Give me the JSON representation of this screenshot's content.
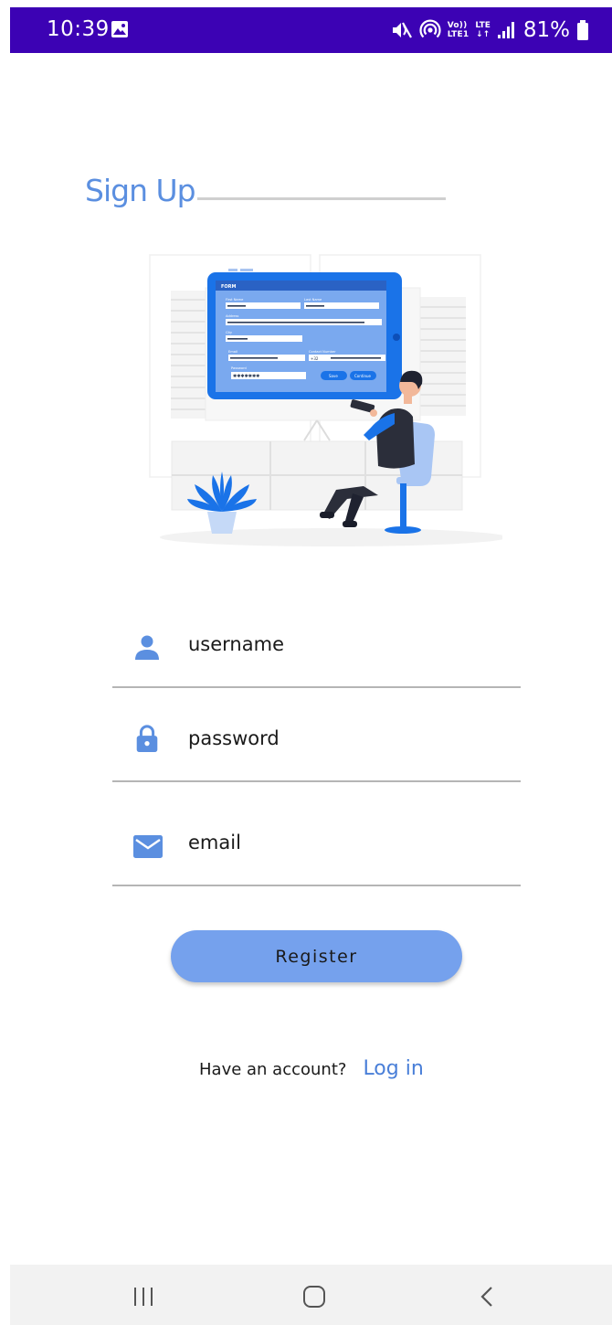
{
  "status_bar": {
    "time": "10:39",
    "battery": "81%",
    "volte_top": "Vo))",
    "volte_bottom": "LTE1",
    "lte_top": "LTE",
    "lte_bottom": "↓↑",
    "icons": [
      "gallery-icon",
      "mute-icon",
      "hotspot-icon",
      "signal-icon",
      "battery-icon"
    ],
    "background": "#3c02b4"
  },
  "header": {
    "title": "Sign Up"
  },
  "illustration": {
    "form_header": "FORM",
    "labels": [
      "First Name",
      "Last Name",
      "Address",
      "City",
      "Email",
      "Contact Number",
      "Password"
    ],
    "buttons": [
      "Save",
      "Continue"
    ],
    "phone_code": "+32",
    "password_dots": "✱✱✱✱✱✱✱"
  },
  "form": {
    "username": {
      "value": "username",
      "icon": "person-icon"
    },
    "password": {
      "value": "password",
      "icon": "lock-icon"
    },
    "email": {
      "value": "email",
      "icon": "mail-icon"
    },
    "accent": "#5b8fe0"
  },
  "actions": {
    "register_label": "Register",
    "register_color": "#75a1ed",
    "login_prompt": "Have an account?",
    "login_link": "Log in"
  },
  "nav": {
    "items": [
      "recents-icon",
      "home-icon",
      "back-icon"
    ]
  }
}
